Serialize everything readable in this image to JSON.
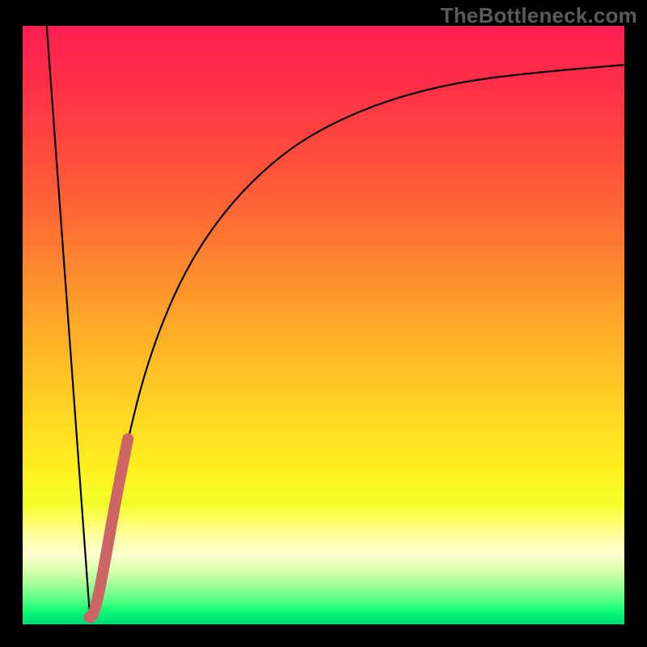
{
  "watermark": "TheBottleneck.com",
  "colors": {
    "frame_bg": "#000000",
    "watermark": "#5a5a5a",
    "curve_stroke": "#000000",
    "highlight_stroke": "#cc6666"
  },
  "chart_data": {
    "type": "line",
    "title": "",
    "xlabel": "",
    "ylabel": "",
    "xlim": [
      0,
      100
    ],
    "ylim": [
      0,
      100
    ],
    "grid": false,
    "legend": false,
    "series": [
      {
        "name": "left-descent",
        "x": [
          4.0,
          11.2
        ],
        "y": [
          100,
          1.0
        ]
      },
      {
        "name": "right-ascent",
        "x": [
          11.2,
          12.5,
          14,
          16,
          18,
          20,
          23,
          27,
          32,
          38,
          45,
          53,
          62,
          72,
          83,
          100
        ],
        "y": [
          1.0,
          6,
          14,
          24,
          33,
          41,
          50,
          59,
          67,
          74,
          80,
          84.5,
          88,
          90.5,
          92,
          93.5
        ]
      },
      {
        "name": "highlight-segment",
        "x": [
          11.1,
          11.6,
          12.9,
          15.5,
          17.5
        ],
        "y": [
          1.2,
          1.0,
          6,
          21,
          31
        ]
      }
    ],
    "gradient_stops": [
      {
        "pos": 0.0,
        "color": "#ff1f52"
      },
      {
        "pos": 0.07,
        "color": "#ff2a4a"
      },
      {
        "pos": 0.18,
        "color": "#ff4240"
      },
      {
        "pos": 0.32,
        "color": "#ff6a34"
      },
      {
        "pos": 0.42,
        "color": "#ff8e2c"
      },
      {
        "pos": 0.52,
        "color": "#ffb027"
      },
      {
        "pos": 0.64,
        "color": "#ffd423"
      },
      {
        "pos": 0.74,
        "color": "#fff01f"
      },
      {
        "pos": 0.8,
        "color": "#f2ff2a"
      },
      {
        "pos": 0.835,
        "color": "#ffff7a"
      },
      {
        "pos": 0.865,
        "color": "#ffffb8"
      },
      {
        "pos": 0.885,
        "color": "#fdffd0"
      },
      {
        "pos": 0.908,
        "color": "#dcffb0"
      },
      {
        "pos": 0.93,
        "color": "#aaff9a"
      },
      {
        "pos": 0.955,
        "color": "#66ff88"
      },
      {
        "pos": 0.975,
        "color": "#1aff77"
      },
      {
        "pos": 0.99,
        "color": "#00e876"
      },
      {
        "pos": 1.0,
        "color": "#00d873"
      }
    ]
  }
}
